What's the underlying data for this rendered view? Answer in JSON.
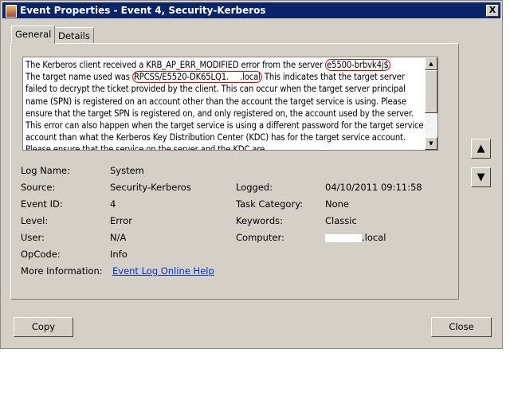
{
  "window": {
    "title": "Event Properties - Event 4, Security-Kerberos"
  },
  "tabs": [
    {
      "label": "General",
      "active": true
    },
    {
      "label": "Details",
      "active": false
    }
  ],
  "description": {
    "pre1": "The Kerberos client received a KRB_AP_ERR_MODIFIED error from the server ",
    "server": "e5500-brbvk4j$",
    "pre2": "The target name used was ",
    "target": "RPCSS/E5520-DK65LQ1.",
    "target_suffix": ".local",
    "rest": " This indicates that the target server failed to decrypt the ticket provided by the client. This can occur when the target server principal name (SPN) is registered on an account other than the account the target service is using. Please ensure that the target SPN is registered on, and only registered on, the account used by the server. This error can also happen when the target service is using a different password for the target service account than what the Kerberos Key Distribution Center (KDC) has for the target service account. Please ensure that the service on the server and the KDC are"
  },
  "fields": {
    "log_name_label": "Log Name:",
    "log_name": "System",
    "source_label": "Source:",
    "source": "Security-Kerberos",
    "logged_label": "Logged:",
    "logged": "04/10/2011 09:11:58",
    "event_id_label": "Event ID:",
    "event_id": "4",
    "task_label": "Task Category:",
    "task": "None",
    "level_label": "Level:",
    "level": "Error",
    "keywords_label": "Keywords:",
    "keywords": "Classic",
    "user_label": "User:",
    "user": "N/A",
    "computer_label": "Computer:",
    "computer": ".local",
    "opcode_label": "OpCode:",
    "opcode": "Info",
    "more_label": "More Information:",
    "more_link": "Event Log Online Help"
  },
  "buttons": {
    "copy": "Copy",
    "close": "Close",
    "close_x": "X",
    "up": "▲",
    "down": "▼"
  }
}
